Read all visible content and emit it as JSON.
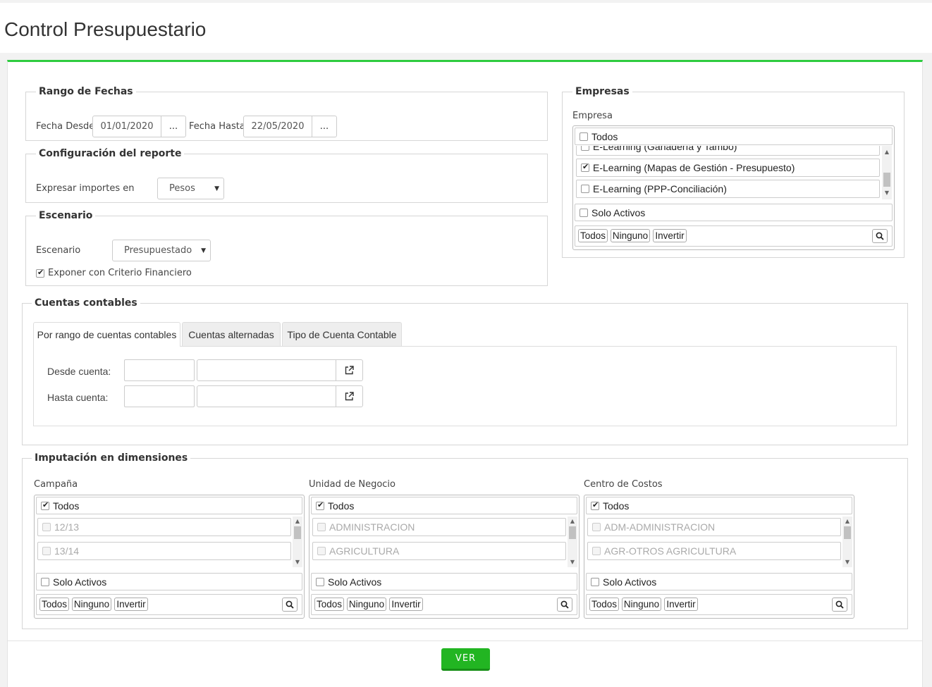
{
  "page": {
    "title": "Control Presupuestario"
  },
  "rango": {
    "legend": "Rango de Fechas",
    "desde_label": "Fecha Desde",
    "desde_value": "01/01/2020",
    "hasta_label": "Fecha Hasta",
    "hasta_value": "22/05/2020",
    "picker_label": "..."
  },
  "config": {
    "legend": "Configuración del reporte",
    "label": "Expresar importes en",
    "value": "Pesos"
  },
  "escenario": {
    "legend": "Escenario",
    "label": "Escenario",
    "value": "Presupuestado",
    "checkbox_label": "Exponer con Criterio Financiero",
    "checkbox_checked": true
  },
  "empresas": {
    "legend": "Empresas",
    "label": "Empresa",
    "todos_label": "Todos",
    "items": [
      {
        "label": "E-Learning (Ganadería y Tambo)",
        "checked": false
      },
      {
        "label": "E-Learning (Mapas de Gestión - Presupuesto)",
        "checked": true
      },
      {
        "label": "E-Learning (PPP-Conciliación)",
        "checked": false
      }
    ],
    "solo_activos": "Solo Activos",
    "btn_todos": "Todos",
    "btn_ninguno": "Ninguno",
    "btn_invertir": "Invertir",
    "search_icon": "search-icon"
  },
  "cuentas": {
    "legend": "Cuentas contables",
    "tabs": [
      {
        "label": "Por rango de cuentas contables",
        "active": true
      },
      {
        "label": "Cuentas alternadas",
        "active": false
      },
      {
        "label": "Tipo de Cuenta Contable",
        "active": false
      }
    ],
    "desde_label": "Desde cuenta:",
    "hasta_label": "Hasta cuenta:",
    "external_icon": "external-link-icon"
  },
  "imputacion": {
    "legend": "Imputación en dimensiones",
    "dimensions": [
      {
        "label": "Campaña",
        "todos": "Todos",
        "items": [
          "12/13",
          "13/14"
        ],
        "solo_activos": "Solo Activos",
        "btn_todos": "Todos",
        "btn_ninguno": "Ninguno",
        "btn_invertir": "Invertir"
      },
      {
        "label": "Unidad de Negocio",
        "todos": "Todos",
        "items": [
          "ADMINISTRACION",
          "AGRICULTURA"
        ],
        "solo_activos": "Solo Activos",
        "btn_todos": "Todos",
        "btn_ninguno": "Ninguno",
        "btn_invertir": "Invertir"
      },
      {
        "label": "Centro de Costos",
        "todos": "Todos",
        "items": [
          "ADM-ADMINISTRACION",
          "AGR-OTROS AGRICULTURA"
        ],
        "solo_activos": "Solo Activos",
        "btn_todos": "Todos",
        "btn_ninguno": "Ninguno",
        "btn_invertir": "Invertir"
      }
    ]
  },
  "actions": {
    "ver_label": "VER"
  },
  "colors": {
    "accent": "#2ecc40",
    "button": "#22b522"
  }
}
